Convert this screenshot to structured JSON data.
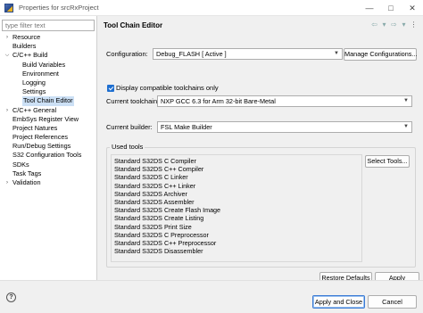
{
  "window": {
    "title": "Properties for srcRxProject",
    "controls": {
      "minimize": "—",
      "maximize": "□",
      "close": "✕"
    }
  },
  "filter": {
    "placeholder": "type filter text"
  },
  "tree": {
    "items": [
      {
        "label": "Resource",
        "level": 0,
        "arrow": "›",
        "selected": false
      },
      {
        "label": "Builders",
        "level": 0,
        "arrow": "",
        "selected": false
      },
      {
        "label": "C/C++ Build",
        "level": 0,
        "arrow": "⌵",
        "selected": false
      },
      {
        "label": "Build Variables",
        "level": 1,
        "arrow": "",
        "selected": false
      },
      {
        "label": "Environment",
        "level": 1,
        "arrow": "",
        "selected": false
      },
      {
        "label": "Logging",
        "level": 1,
        "arrow": "",
        "selected": false
      },
      {
        "label": "Settings",
        "level": 1,
        "arrow": "",
        "selected": false
      },
      {
        "label": "Tool Chain Editor",
        "level": 1,
        "arrow": "",
        "selected": true
      },
      {
        "label": "C/C++ General",
        "level": 0,
        "arrow": "›",
        "selected": false
      },
      {
        "label": "EmbSys Register View",
        "level": 0,
        "arrow": "",
        "selected": false
      },
      {
        "label": "Project Natures",
        "level": 0,
        "arrow": "",
        "selected": false
      },
      {
        "label": "Project References",
        "level": 0,
        "arrow": "",
        "selected": false
      },
      {
        "label": "Run/Debug Settings",
        "level": 0,
        "arrow": "",
        "selected": false
      },
      {
        "label": "S32 Configuration Tools",
        "level": 0,
        "arrow": "",
        "selected": false
      },
      {
        "label": "SDKs",
        "level": 0,
        "arrow": "",
        "selected": false
      },
      {
        "label": "Task Tags",
        "level": 0,
        "arrow": "",
        "selected": false
      },
      {
        "label": "Validation",
        "level": 0,
        "arrow": "›",
        "selected": false
      }
    ]
  },
  "page": {
    "title": "Tool Chain Editor",
    "nav": {
      "back": "⇦",
      "back_menu": "▾",
      "forward": "⇨",
      "forward_menu": "▾",
      "view_menu": "⋮"
    }
  },
  "configuration": {
    "label": "Configuration:",
    "value": "Debug_FLASH  [ Active ]",
    "manage_label": "Manage Configurations..."
  },
  "display_compatible": {
    "label": "Display compatible toolchains only",
    "checked": true
  },
  "current_toolchain": {
    "label": "Current toolchain:",
    "value": "NXP GCC 6.3 for Arm 32-bit Bare-Metal"
  },
  "current_builder": {
    "label": "Current builder:",
    "value": "FSL Make Builder"
  },
  "used_tools": {
    "label": "Used tools",
    "select_label": "Select Tools...",
    "items": [
      "Standard S32DS C Compiler",
      "Standard S32DS C++ Compiler",
      "Standard S32DS C Linker",
      "Standard S32DS C++ Linker",
      "Standard S32DS Archiver",
      "Standard S32DS Assembler",
      "Standard S32DS Create Flash Image",
      "Standard S32DS Create Listing",
      "Standard S32DS Print Size",
      "Standard S32DS C Preprocessor",
      "Standard S32DS C++ Preprocessor",
      "Standard S32DS Disassembler"
    ]
  },
  "buttons": {
    "restore_defaults": "Restore Defaults",
    "apply": "Apply",
    "apply_and_close": "Apply and Close",
    "cancel": "Cancel"
  },
  "help": {
    "glyph": "?"
  },
  "colors": {
    "accent": "#1f6fd0",
    "selection": "#cce0f5"
  }
}
